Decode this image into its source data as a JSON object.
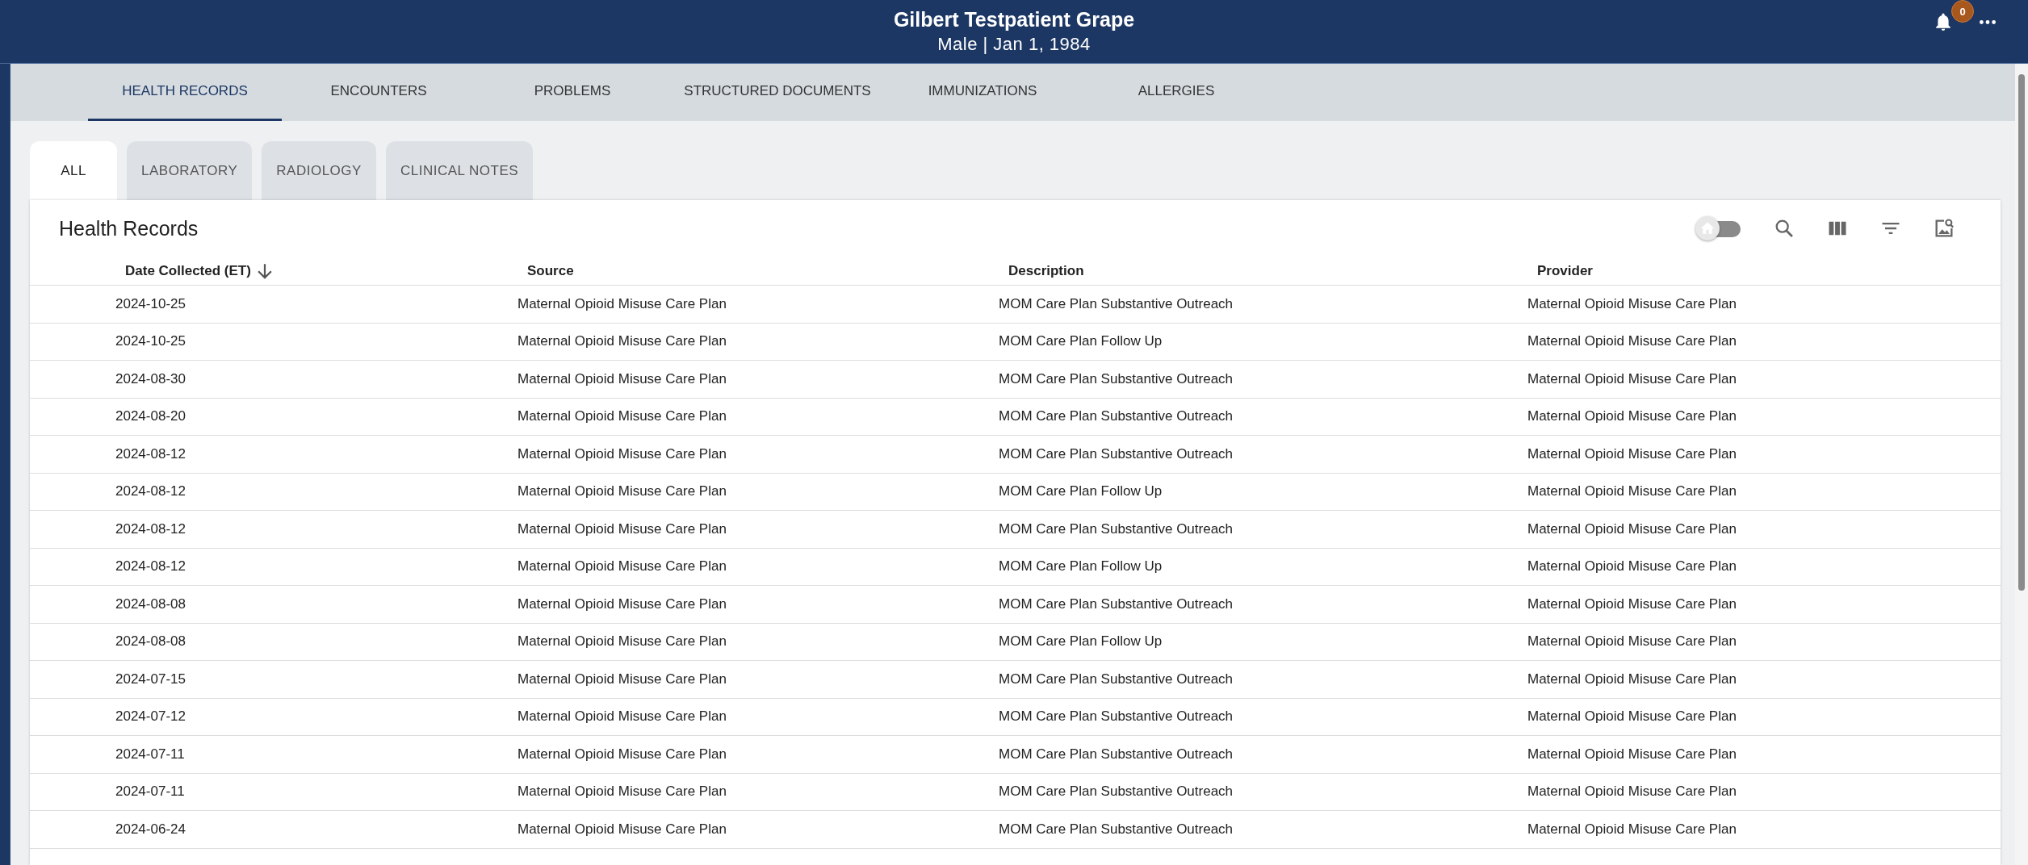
{
  "patient": {
    "name": "Gilbert Testpatient Grape",
    "details": "Male | Jan 1, 1984"
  },
  "notifications": {
    "count": "0"
  },
  "nav_tabs": [
    {
      "label": "HEALTH RECORDS",
      "selected": true
    },
    {
      "label": "ENCOUNTERS",
      "selected": false
    },
    {
      "label": "PROBLEMS",
      "selected": false
    },
    {
      "label": "STRUCTURED DOCUMENTS",
      "selected": false
    },
    {
      "label": "IMMUNIZATIONS",
      "selected": false
    },
    {
      "label": "ALLERGIES",
      "selected": false
    }
  ],
  "record_tabs": [
    {
      "label": "ALL",
      "selected": true
    },
    {
      "label": "LABORATORY",
      "selected": false
    },
    {
      "label": "RADIOLOGY",
      "selected": false
    },
    {
      "label": "CLINICAL NOTES",
      "selected": false
    }
  ],
  "table": {
    "title": "Health Records",
    "toggle": {
      "on": false
    },
    "columns": [
      {
        "label": "Date Collected (ET)",
        "sorted": true
      },
      {
        "label": "Source",
        "sorted": false
      },
      {
        "label": "Description",
        "sorted": false
      },
      {
        "label": "Provider",
        "sorted": false
      }
    ],
    "rows": [
      [
        "2024-10-25",
        "Maternal Opioid Misuse Care Plan",
        "MOM Care Plan Substantive Outreach",
        "Maternal Opioid Misuse Care Plan"
      ],
      [
        "2024-10-25",
        "Maternal Opioid Misuse Care Plan",
        "MOM Care Plan Follow Up",
        "Maternal Opioid Misuse Care Plan"
      ],
      [
        "2024-08-30",
        "Maternal Opioid Misuse Care Plan",
        "MOM Care Plan Substantive Outreach",
        "Maternal Opioid Misuse Care Plan"
      ],
      [
        "2024-08-20",
        "Maternal Opioid Misuse Care Plan",
        "MOM Care Plan Substantive Outreach",
        "Maternal Opioid Misuse Care Plan"
      ],
      [
        "2024-08-12",
        "Maternal Opioid Misuse Care Plan",
        "MOM Care Plan Substantive Outreach",
        "Maternal Opioid Misuse Care Plan"
      ],
      [
        "2024-08-12",
        "Maternal Opioid Misuse Care Plan",
        "MOM Care Plan Follow Up",
        "Maternal Opioid Misuse Care Plan"
      ],
      [
        "2024-08-12",
        "Maternal Opioid Misuse Care Plan",
        "MOM Care Plan Substantive Outreach",
        "Maternal Opioid Misuse Care Plan"
      ],
      [
        "2024-08-12",
        "Maternal Opioid Misuse Care Plan",
        "MOM Care Plan Follow Up",
        "Maternal Opioid Misuse Care Plan"
      ],
      [
        "2024-08-08",
        "Maternal Opioid Misuse Care Plan",
        "MOM Care Plan Substantive Outreach",
        "Maternal Opioid Misuse Care Plan"
      ],
      [
        "2024-08-08",
        "Maternal Opioid Misuse Care Plan",
        "MOM Care Plan Follow Up",
        "Maternal Opioid Misuse Care Plan"
      ],
      [
        "2024-07-15",
        "Maternal Opioid Misuse Care Plan",
        "MOM Care Plan Substantive Outreach",
        "Maternal Opioid Misuse Care Plan"
      ],
      [
        "2024-07-12",
        "Maternal Opioid Misuse Care Plan",
        "MOM Care Plan Substantive Outreach",
        "Maternal Opioid Misuse Care Plan"
      ],
      [
        "2024-07-11",
        "Maternal Opioid Misuse Care Plan",
        "MOM Care Plan Substantive Outreach",
        "Maternal Opioid Misuse Care Plan"
      ],
      [
        "2024-07-11",
        "Maternal Opioid Misuse Care Plan",
        "MOM Care Plan Substantive Outreach",
        "Maternal Opioid Misuse Care Plan"
      ],
      [
        "2024-06-24",
        "Maternal Opioid Misuse Care Plan",
        "MOM Care Plan Substantive Outreach",
        "Maternal Opioid Misuse Care Plan"
      ]
    ]
  }
}
